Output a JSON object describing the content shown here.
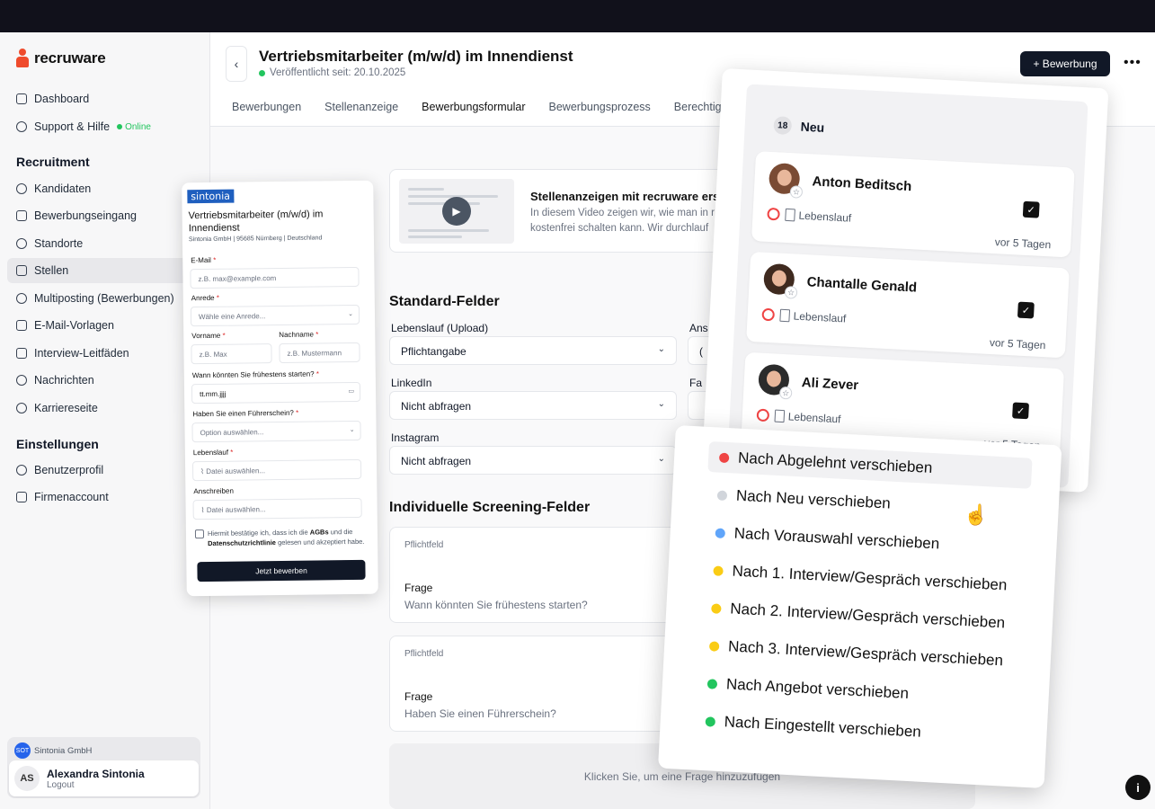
{
  "sidebar": {
    "brand": "recruware",
    "top_items": [
      {
        "label": "Dashboard",
        "icon": "home-icon"
      },
      {
        "label": "Support & Hilfe",
        "icon": "headset-icon",
        "badge": "Online"
      }
    ],
    "section_recruitment": "Recruitment",
    "recruitment_items": [
      {
        "label": "Kandidaten",
        "icon": "users-icon"
      },
      {
        "label": "Bewerbungseingang",
        "icon": "folder-icon"
      },
      {
        "label": "Standorte",
        "icon": "map-pin-icon"
      },
      {
        "label": "Stellen",
        "icon": "briefcase-icon",
        "active": true
      },
      {
        "label": "Multiposting (Bewerbungen)",
        "icon": "toggle-icon"
      },
      {
        "label": "E-Mail-Vorlagen",
        "icon": "list-icon"
      },
      {
        "label": "Interview-Leitfäden",
        "icon": "copy-icon"
      },
      {
        "label": "Nachrichten",
        "icon": "chat-icon"
      },
      {
        "label": "Karriereseite",
        "icon": "gear-icon"
      }
    ],
    "section_settings": "Einstellungen",
    "settings_items": [
      {
        "label": "Benutzerprofil",
        "icon": "user-circle-icon"
      },
      {
        "label": "Firmenaccount",
        "icon": "building-icon"
      }
    ],
    "org_name": "Sintonia GmbH",
    "org_logo_text": "SOT",
    "user_initials": "AS",
    "user_name": "Alexandra Sintonia",
    "logout_label": "Logout"
  },
  "header": {
    "title": "Vertriebsmitarbeiter (m/w/d) im Innendienst",
    "published": "Veröffentlicht seit: 20.10.2025",
    "primary_button": "+ Bewerbung",
    "more_label": "•••",
    "tabs": [
      "Bewerbungen",
      "Stellenanzeige",
      "Bewerbungsformular",
      "Bewerbungsprozess",
      "Berechtigu"
    ],
    "active_tab": "Bewerbungsformular"
  },
  "video": {
    "title": "Stellenanzeigen mit recruware ers",
    "desc_line1": "In diesem Video zeigen wir, wie man in r",
    "desc_line2": "kostenfrei schalten kann. Wir durchlauf"
  },
  "standard": {
    "heading": "Standard-Felder",
    "fields": [
      {
        "label": "Lebenslauf (Upload)",
        "value": "Pflichtangabe"
      },
      {
        "label": "LinkedIn",
        "value": "Nicht abfragen"
      },
      {
        "label": "Instagram",
        "value": "Nicht abfragen"
      }
    ],
    "right_labels": [
      "Ans",
      "Fa"
    ],
    "right_value_start": "("
  },
  "screening": {
    "heading": "Individuelle Screening-Felder",
    "cards": [
      {
        "tag": "Pflichtfeld",
        "label": "Frage",
        "value": "Wann könnten Sie frühestens starten?"
      },
      {
        "tag": "Pflichtfeld",
        "label": "Frage",
        "value": "Haben Sie einen Führerschein?"
      }
    ],
    "add_label": "Klicken Sie, um eine Frage hinzuzufügen"
  },
  "form_preview": {
    "brand": "sintonia",
    "title": "Vertriebsmitarbeiter (m/w/d) im Innendienst",
    "subtitle": "Sintonia GmbH | 95685 Nürnberg | Deutschland",
    "email_label": "E-Mail",
    "email_placeholder": "z.B. max@example.com",
    "anrede_label": "Anrede",
    "anrede_placeholder": "Wähle eine Anrede...",
    "vorname_label": "Vorname",
    "vorname_placeholder": "z.B. Max",
    "nachname_label": "Nachname",
    "nachname_placeholder": "z.B. Mustermann",
    "start_label": "Wann könnten Sie frühestens starten?",
    "start_placeholder": "tt.mm.jjjj",
    "license_label": "Haben Sie einen Führerschein?",
    "license_placeholder": "Option auswählen...",
    "cv_label": "Lebenslauf",
    "cv_placeholder": "Datei auswählen...",
    "cover_label": "Anschreiben",
    "cover_placeholder": "Datei auswählen...",
    "consent_a": "Hiermit bestätige ich, dass ich die ",
    "consent_agb": "AGBs",
    "consent_b": " und die ",
    "consent_privacy": "Datenschutzrichtlinie",
    "consent_c": " gelesen und akzeptiert habe.",
    "submit": "Jetzt bewerben",
    "required_mark": "*"
  },
  "kanban": {
    "count": "18",
    "column_title": "Neu",
    "cards": [
      {
        "name": "Anton Beditsch",
        "doc": "Lebenslauf",
        "time": "vor 5 Tagen"
      },
      {
        "name": "Chantalle Genald",
        "doc": "Lebenslauf",
        "time": "vor 5 Tagen"
      },
      {
        "name": "Ali Zever",
        "doc": "Lebenslauf",
        "time": "vor 5 Tagen"
      }
    ]
  },
  "context_menu": {
    "items": [
      {
        "label": "Nach Abgelehnt verschieben",
        "color": "#ef4444"
      },
      {
        "label": "Nach Neu verschieben",
        "color": "#d1d5db"
      },
      {
        "label": "Nach Vorauswahl verschieben",
        "color": "#60a5fa"
      },
      {
        "label": "Nach 1. Interview/Gespräch verschieben",
        "color": "#facc15"
      },
      {
        "label": "Nach 2. Interview/Gespräch verschieben",
        "color": "#facc15"
      },
      {
        "label": "Nach 3. Interview/Gespräch verschieben",
        "color": "#facc15"
      },
      {
        "label": "Nach Angebot verschieben",
        "color": "#22c55e"
      },
      {
        "label": "Nach Eingestellt verschieben",
        "color": "#22c55e"
      }
    ]
  },
  "info_label": "i"
}
